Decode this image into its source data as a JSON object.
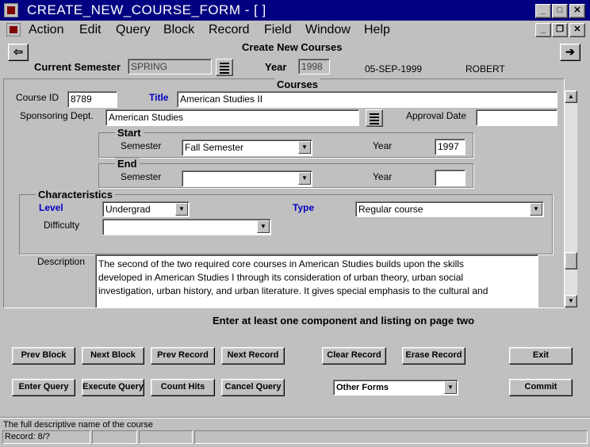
{
  "window": {
    "title": "CREATE_NEW_COURSE_FORM - [ ]"
  },
  "menu": {
    "items": [
      "Action",
      "Edit",
      "Query",
      "Block",
      "Record",
      "Field",
      "Window",
      "Help"
    ]
  },
  "header": {
    "form_title": "Create New Courses",
    "current_semester_label": "Current Semester",
    "current_semester_value": "SPRING",
    "year_label": "Year",
    "year_value": "1998",
    "date": "05-SEP-1999",
    "user": "ROBERT"
  },
  "courses": {
    "block_title": "Courses",
    "course_id_label": "Course ID",
    "course_id_value": "8789",
    "title_label": "Title",
    "title_value": "American Studies II",
    "dept_label": "Sponsoring Dept.",
    "dept_value": "American Studies",
    "approval_label": "Approval Date",
    "approval_value": "",
    "start": {
      "title": "Start",
      "semester_label": "Semester",
      "semester_value": "Fall Semester",
      "year_label": "Year",
      "year_value": "1997"
    },
    "end": {
      "title": "End",
      "semester_label": "Semester",
      "semester_value": "",
      "year_label": "Year",
      "year_value": ""
    },
    "characteristics": {
      "title": "Characteristics",
      "level_label": "Level",
      "level_value": "Undergrad",
      "type_label": "Type",
      "type_value": "Regular course",
      "difficulty_label": "Difficulty",
      "difficulty_value": ""
    },
    "description_label": "Description",
    "description_lines": [
      "The second of the two required core courses in American Studies builds upon the skills",
      "developed in American Studies I through its consideration of urban theory, urban social",
      "investigation, urban history, and urban literature.  It gives special emphasis to the cultural and"
    ]
  },
  "hint": "Enter at least one component and listing on page two",
  "buttons": {
    "prev_block": "Prev Block",
    "next_block": "Next Block",
    "prev_record": "Prev Record",
    "next_record": "Next Record",
    "clear_record": "Clear Record",
    "erase_record": "Erase Record",
    "exit": "Exit",
    "enter_query": "Enter Query",
    "execute_query": "Execute Query",
    "count_hits": "Count Hits",
    "cancel_query": "Cancel Query",
    "other_forms": "Other Forms",
    "commit": "Commit"
  },
  "statusbar": {
    "message": "The full descriptive name of the course",
    "record": "Record: 8/?"
  },
  "colors": {
    "titlebar": "#000080",
    "label_blue": "#0000c0",
    "face": "#c0c0c0"
  }
}
